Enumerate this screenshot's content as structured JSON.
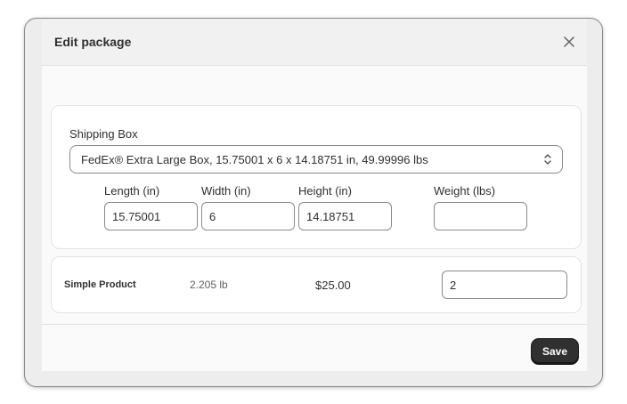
{
  "modal": {
    "title": "Edit package",
    "close_icon": "close-icon"
  },
  "shipping_box": {
    "label": "Shipping Box",
    "selected": "FedEx® Extra Large Box, 15.75001 x 6 x 14.18751 in, 49.99996 lbs",
    "arrows_icon": "select-arrows-icon"
  },
  "dimensions": {
    "length": {
      "label": "Length (in)",
      "value": "15.75001"
    },
    "width": {
      "label": "Width (in)",
      "value": "6"
    },
    "height": {
      "label": "Height (in)",
      "value": "14.18751"
    },
    "weight": {
      "label": "Weight (lbs)",
      "value": ""
    }
  },
  "product": {
    "name": "Simple Product",
    "weight": "2.205 lb",
    "price": "$25.00",
    "quantity": "2"
  },
  "footer": {
    "save_label": "Save"
  },
  "colors": {
    "primary_button": "#303030",
    "border": "#8a8a8a",
    "background": "#ededed"
  }
}
